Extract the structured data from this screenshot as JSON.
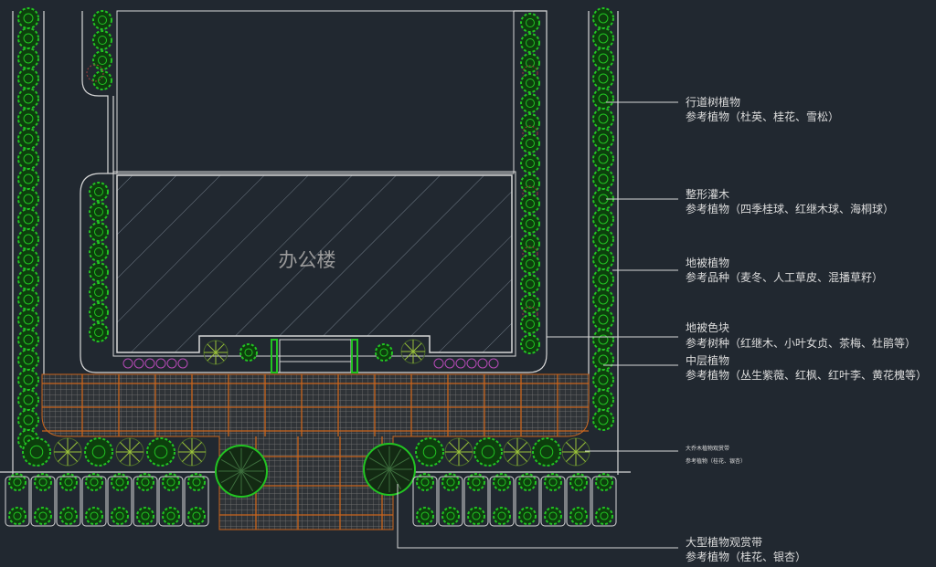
{
  "building": {
    "label": "办公楼"
  },
  "annotations": [
    {
      "title": "行道树植物",
      "detail": "参考植物（杜英、桂花、雪松）"
    },
    {
      "title": "整形灌木",
      "detail": "参考植物（四季桂球、红继木球、海桐球）"
    },
    {
      "title": "地被植物",
      "detail": "参考品种（麦冬、人工草皮、混播草籽）"
    },
    {
      "title": "地被色块",
      "detail": "参考树种（红继木、小叶女贞、茶梅、杜鹃等）"
    },
    {
      "title": "中层植物",
      "detail": "参考植物（丛生紫薇、红枫、红叶李、黄花槐等）"
    },
    {
      "title": "大乔木植物观赏带",
      "detail": "参考植物（桂花、银杏）"
    },
    {
      "title": "大型植物观赏带",
      "detail": "参考植物（桂花、银杏）"
    }
  ],
  "colors": {
    "background": "#212830",
    "linework": "#d8d8d8",
    "tree_green": "#22c422",
    "tree_dark": "#0d3f0d",
    "shrub_red": "#8a3a3a",
    "groundcover_purple": "#b64ab6",
    "paving_grid": "#7a7a7a",
    "paving_orange": "#c9651c"
  }
}
